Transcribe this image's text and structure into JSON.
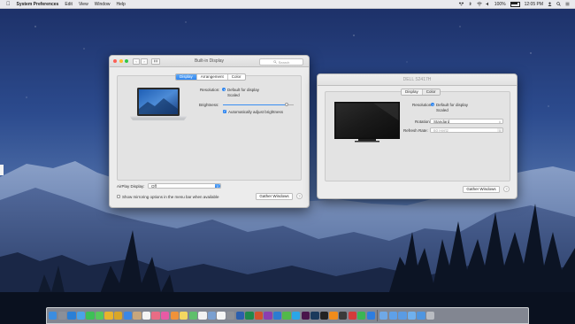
{
  "menubar": {
    "app_name": "System Preferences",
    "menus": [
      "Edit",
      "View",
      "Window",
      "Help"
    ],
    "battery": "100%",
    "datetime": "12:05 PM",
    "icons": [
      "apple-icon",
      "dropbox-icon",
      "bluetooth-icon",
      "wifi-icon",
      "volume-icon",
      "battery-icon",
      "user-icon",
      "search-icon",
      "notification-center-icon"
    ]
  },
  "builtin_window": {
    "title": "Built-in Display",
    "search_placeholder": "Search",
    "nav_back": "‹",
    "nav_forward": "›",
    "tabs": [
      "Display",
      "Arrangement",
      "Color"
    ],
    "active_tab": "Display",
    "resolution_label": "Resolution:",
    "resolution_options": [
      "Default for display",
      "Scaled"
    ],
    "resolution_selected": "Default for display",
    "brightness_label": "Brightness:",
    "brightness_level": 0.9,
    "auto_brightness_label": "Automatically adjust brightness",
    "auto_brightness_checked": true,
    "airplay_label": "AirPlay Display:",
    "airplay_value": "Off",
    "mirroring_label": "Show mirroring options in the menu bar when available",
    "mirroring_checked": false,
    "gather_label": "Gather Windows",
    "help": "?"
  },
  "dell_window": {
    "title": "DELL S2417H",
    "tabs": [
      "Display",
      "Color"
    ],
    "active_tab": "Display",
    "resolution_label": "Resolution:",
    "resolution_options": [
      "Default for display",
      "Scaled"
    ],
    "resolution_selected": "Default for display",
    "rotation_label": "Rotation:",
    "rotation_value": "Standard",
    "refresh_label": "Refresh Rate:",
    "refresh_value": "60 Hertz",
    "gather_label": "Gather Windows",
    "help": "?"
  },
  "dock": {
    "icons": [
      {
        "name": "finder-icon",
        "color": "#3b8de0"
      },
      {
        "name": "launchpad-icon",
        "color": "#8a8f99"
      },
      {
        "name": "safari-icon",
        "color": "#2a7fd6"
      },
      {
        "name": "mail-icon",
        "color": "#4aa3e8"
      },
      {
        "name": "facetime-icon",
        "color": "#3cc156"
      },
      {
        "name": "messages-icon",
        "color": "#57c95b"
      },
      {
        "name": "chrome-icon",
        "color": "#e9b42c"
      },
      {
        "name": "chrome-canary-icon",
        "color": "#d9a627"
      },
      {
        "name": "app-store-icon",
        "color": "#3a87e6"
      },
      {
        "name": "contacts-icon",
        "color": "#c7a67c"
      },
      {
        "name": "calendar-icon",
        "color": "#f4f4f4"
      },
      {
        "name": "photos-icon",
        "color": "#e96c85"
      },
      {
        "name": "itunes-icon",
        "color": "#e85aa5"
      },
      {
        "name": "ibooks-icon",
        "color": "#f0923a"
      },
      {
        "name": "notes-icon",
        "color": "#f4d761"
      },
      {
        "name": "maps-icon",
        "color": "#5fbf6b"
      },
      {
        "name": "reminders-icon",
        "color": "#f2f2f2"
      },
      {
        "name": "preview-icon",
        "color": "#7a9fd0"
      },
      {
        "name": "textedit-icon",
        "color": "#f5f5f5"
      },
      {
        "name": "system-preferences-icon",
        "color": "#8d9097"
      },
      {
        "name": "word-icon",
        "color": "#2b5fae"
      },
      {
        "name": "excel-icon",
        "color": "#1f8a4a"
      },
      {
        "name": "powerpoint-icon",
        "color": "#d2532d"
      },
      {
        "name": "onenote-icon",
        "color": "#8b3fb0"
      },
      {
        "name": "outlook-icon",
        "color": "#2c7cd1"
      },
      {
        "name": "evernote-icon",
        "color": "#52b94a"
      },
      {
        "name": "skype-icon",
        "color": "#2aa6e8"
      },
      {
        "name": "slack-icon",
        "color": "#4a154b"
      },
      {
        "name": "steam-icon",
        "color": "#1b3a5c"
      },
      {
        "name": "terminal-icon",
        "color": "#222"
      },
      {
        "name": "vlc-icon",
        "color": "#f08c1c"
      },
      {
        "name": "activity-monitor-icon",
        "color": "#3a3a3a"
      },
      {
        "name": "screenshot-icon",
        "color": "#d33b3b"
      },
      {
        "name": "spotify-icon",
        "color": "#3bb654"
      },
      {
        "name": "dropbox-app-icon",
        "color": "#2d7de0"
      },
      {
        "name": "downloads-folder-icon",
        "color": "#6fa8e6"
      },
      {
        "name": "documents-folder-icon",
        "color": "#5ea0e8"
      },
      {
        "name": "applications-folder-icon",
        "color": "#5a9be3"
      },
      {
        "name": "desktop-folder-icon",
        "color": "#6fb0ee"
      },
      {
        "name": "pictures-folder-icon",
        "color": "#4f95df"
      },
      {
        "name": "trash-icon",
        "color": "#b9bcc2"
      }
    ]
  }
}
